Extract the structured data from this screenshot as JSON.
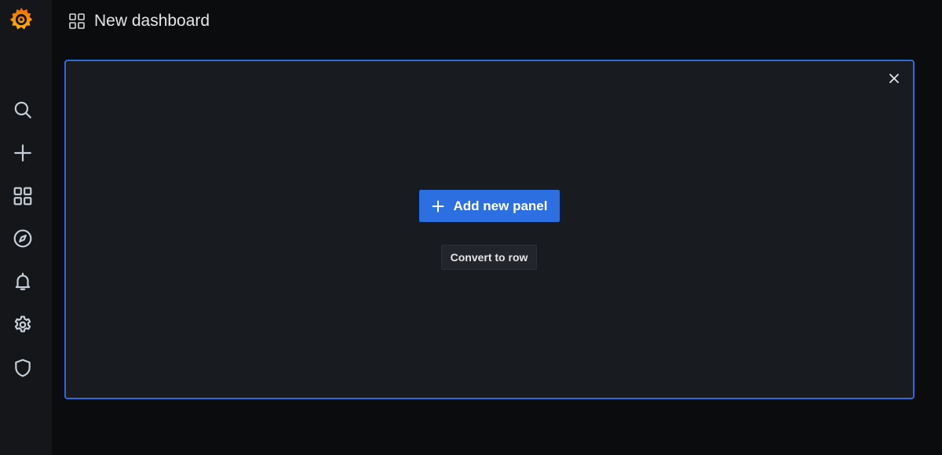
{
  "header": {
    "title": "New dashboard"
  },
  "sidebar": {
    "items": [
      {
        "icon": "search-icon"
      },
      {
        "icon": "plus-icon"
      },
      {
        "icon": "dashboards-icon"
      },
      {
        "icon": "compass-icon"
      },
      {
        "icon": "bell-icon"
      },
      {
        "icon": "gear-icon"
      },
      {
        "icon": "shield-icon"
      }
    ]
  },
  "panel": {
    "add_button_label": "Add new panel",
    "convert_button_label": "Convert to row"
  },
  "colors": {
    "accent": "#2c6fe0",
    "panel_border": "#2f6bd6",
    "logo_orange": "#f46800",
    "logo_yellow": "#fbb612"
  }
}
